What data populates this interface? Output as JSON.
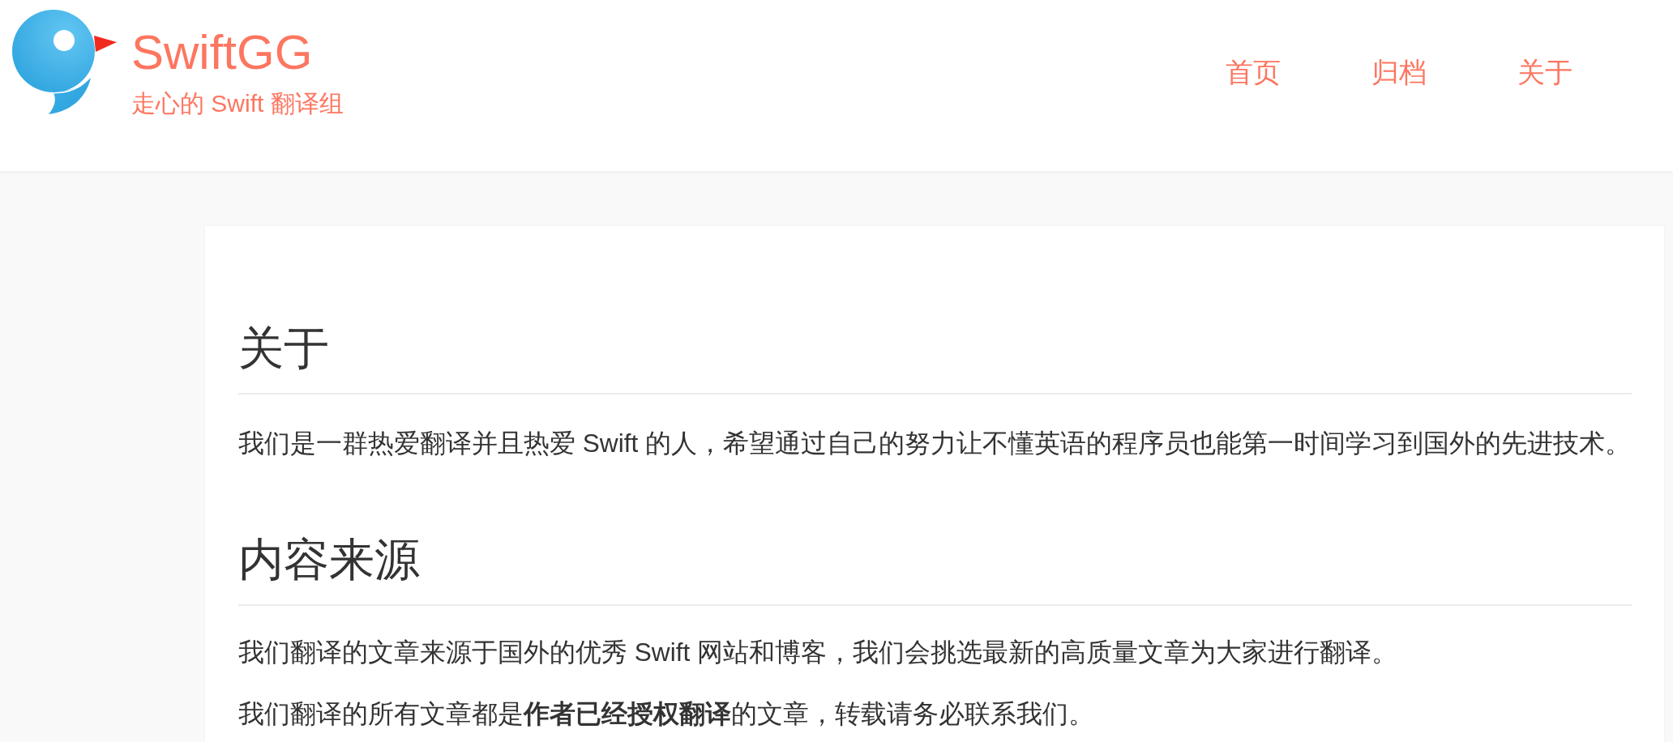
{
  "header": {
    "logo": {
      "title": "SwiftGG",
      "subtitle": "走心的 Swift 翻译组"
    },
    "nav": [
      {
        "label": "首页"
      },
      {
        "label": "归档"
      },
      {
        "label": "关于"
      }
    ]
  },
  "article": {
    "sections": [
      {
        "heading": "关于",
        "paragraphs": [
          "我们是一群热爱翻译并且热爱 Swift 的人，希望通过自己的努力让不懂英语的程序员也能第一时间学习到国外的先进技术。"
        ]
      },
      {
        "heading": "内容来源",
        "paragraphs": [
          "我们翻译的文章来源于国外的优秀 Swift 网站和博客，我们会挑选最新的高质量文章为大家进行翻译。",
          "我们翻译的所有文章都是**作者已经授权翻译**的文章，转载请务必联系我们。"
        ]
      }
    ]
  }
}
